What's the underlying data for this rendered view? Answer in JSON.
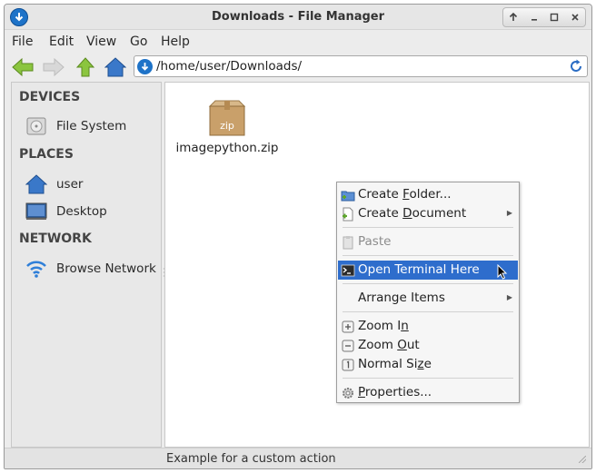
{
  "window": {
    "title": "Downloads - File Manager"
  },
  "menubar": [
    "File",
    "Edit",
    "View",
    "Go",
    "Help"
  ],
  "toolbar": {
    "location": "/home/user/Downloads/"
  },
  "sidebar": {
    "devices_title": "DEVICES",
    "places_title": "PLACES",
    "network_title": "NETWORK",
    "devices": [
      {
        "label": "File System",
        "icon": "drive-icon"
      }
    ],
    "places": [
      {
        "label": "user",
        "icon": "home-icon"
      },
      {
        "label": "Desktop",
        "icon": "desktop-icon"
      }
    ],
    "network": [
      {
        "label": "Browse Network",
        "icon": "wifi-icon"
      }
    ]
  },
  "files": [
    {
      "name": "imagepython.zip",
      "icon": "zip-archive-icon",
      "icon_text": "zip"
    }
  ],
  "context_menu": {
    "create_folder": {
      "pre": "Create ",
      "u": "F",
      "post": "older..."
    },
    "create_document": {
      "pre": "Create ",
      "u": "D",
      "post": "ocument"
    },
    "paste": "Paste",
    "open_terminal": "Open Terminal Here",
    "arrange_items": "Arrange Items",
    "zoom_in": {
      "pre": "Zoom I",
      "u": "n",
      "post": ""
    },
    "zoom_out": {
      "pre": "Zoom ",
      "u": "O",
      "post": "ut"
    },
    "normal_size": {
      "pre": "Normal Si",
      "u": "z",
      "post": "e"
    },
    "properties": {
      "pre": "",
      "u": "P",
      "post": "roperties..."
    }
  },
  "status": {
    "text": "Example for a custom action"
  },
  "colors": {
    "accent": "#2e6dcc",
    "arrow_green": "#7cb82f"
  }
}
